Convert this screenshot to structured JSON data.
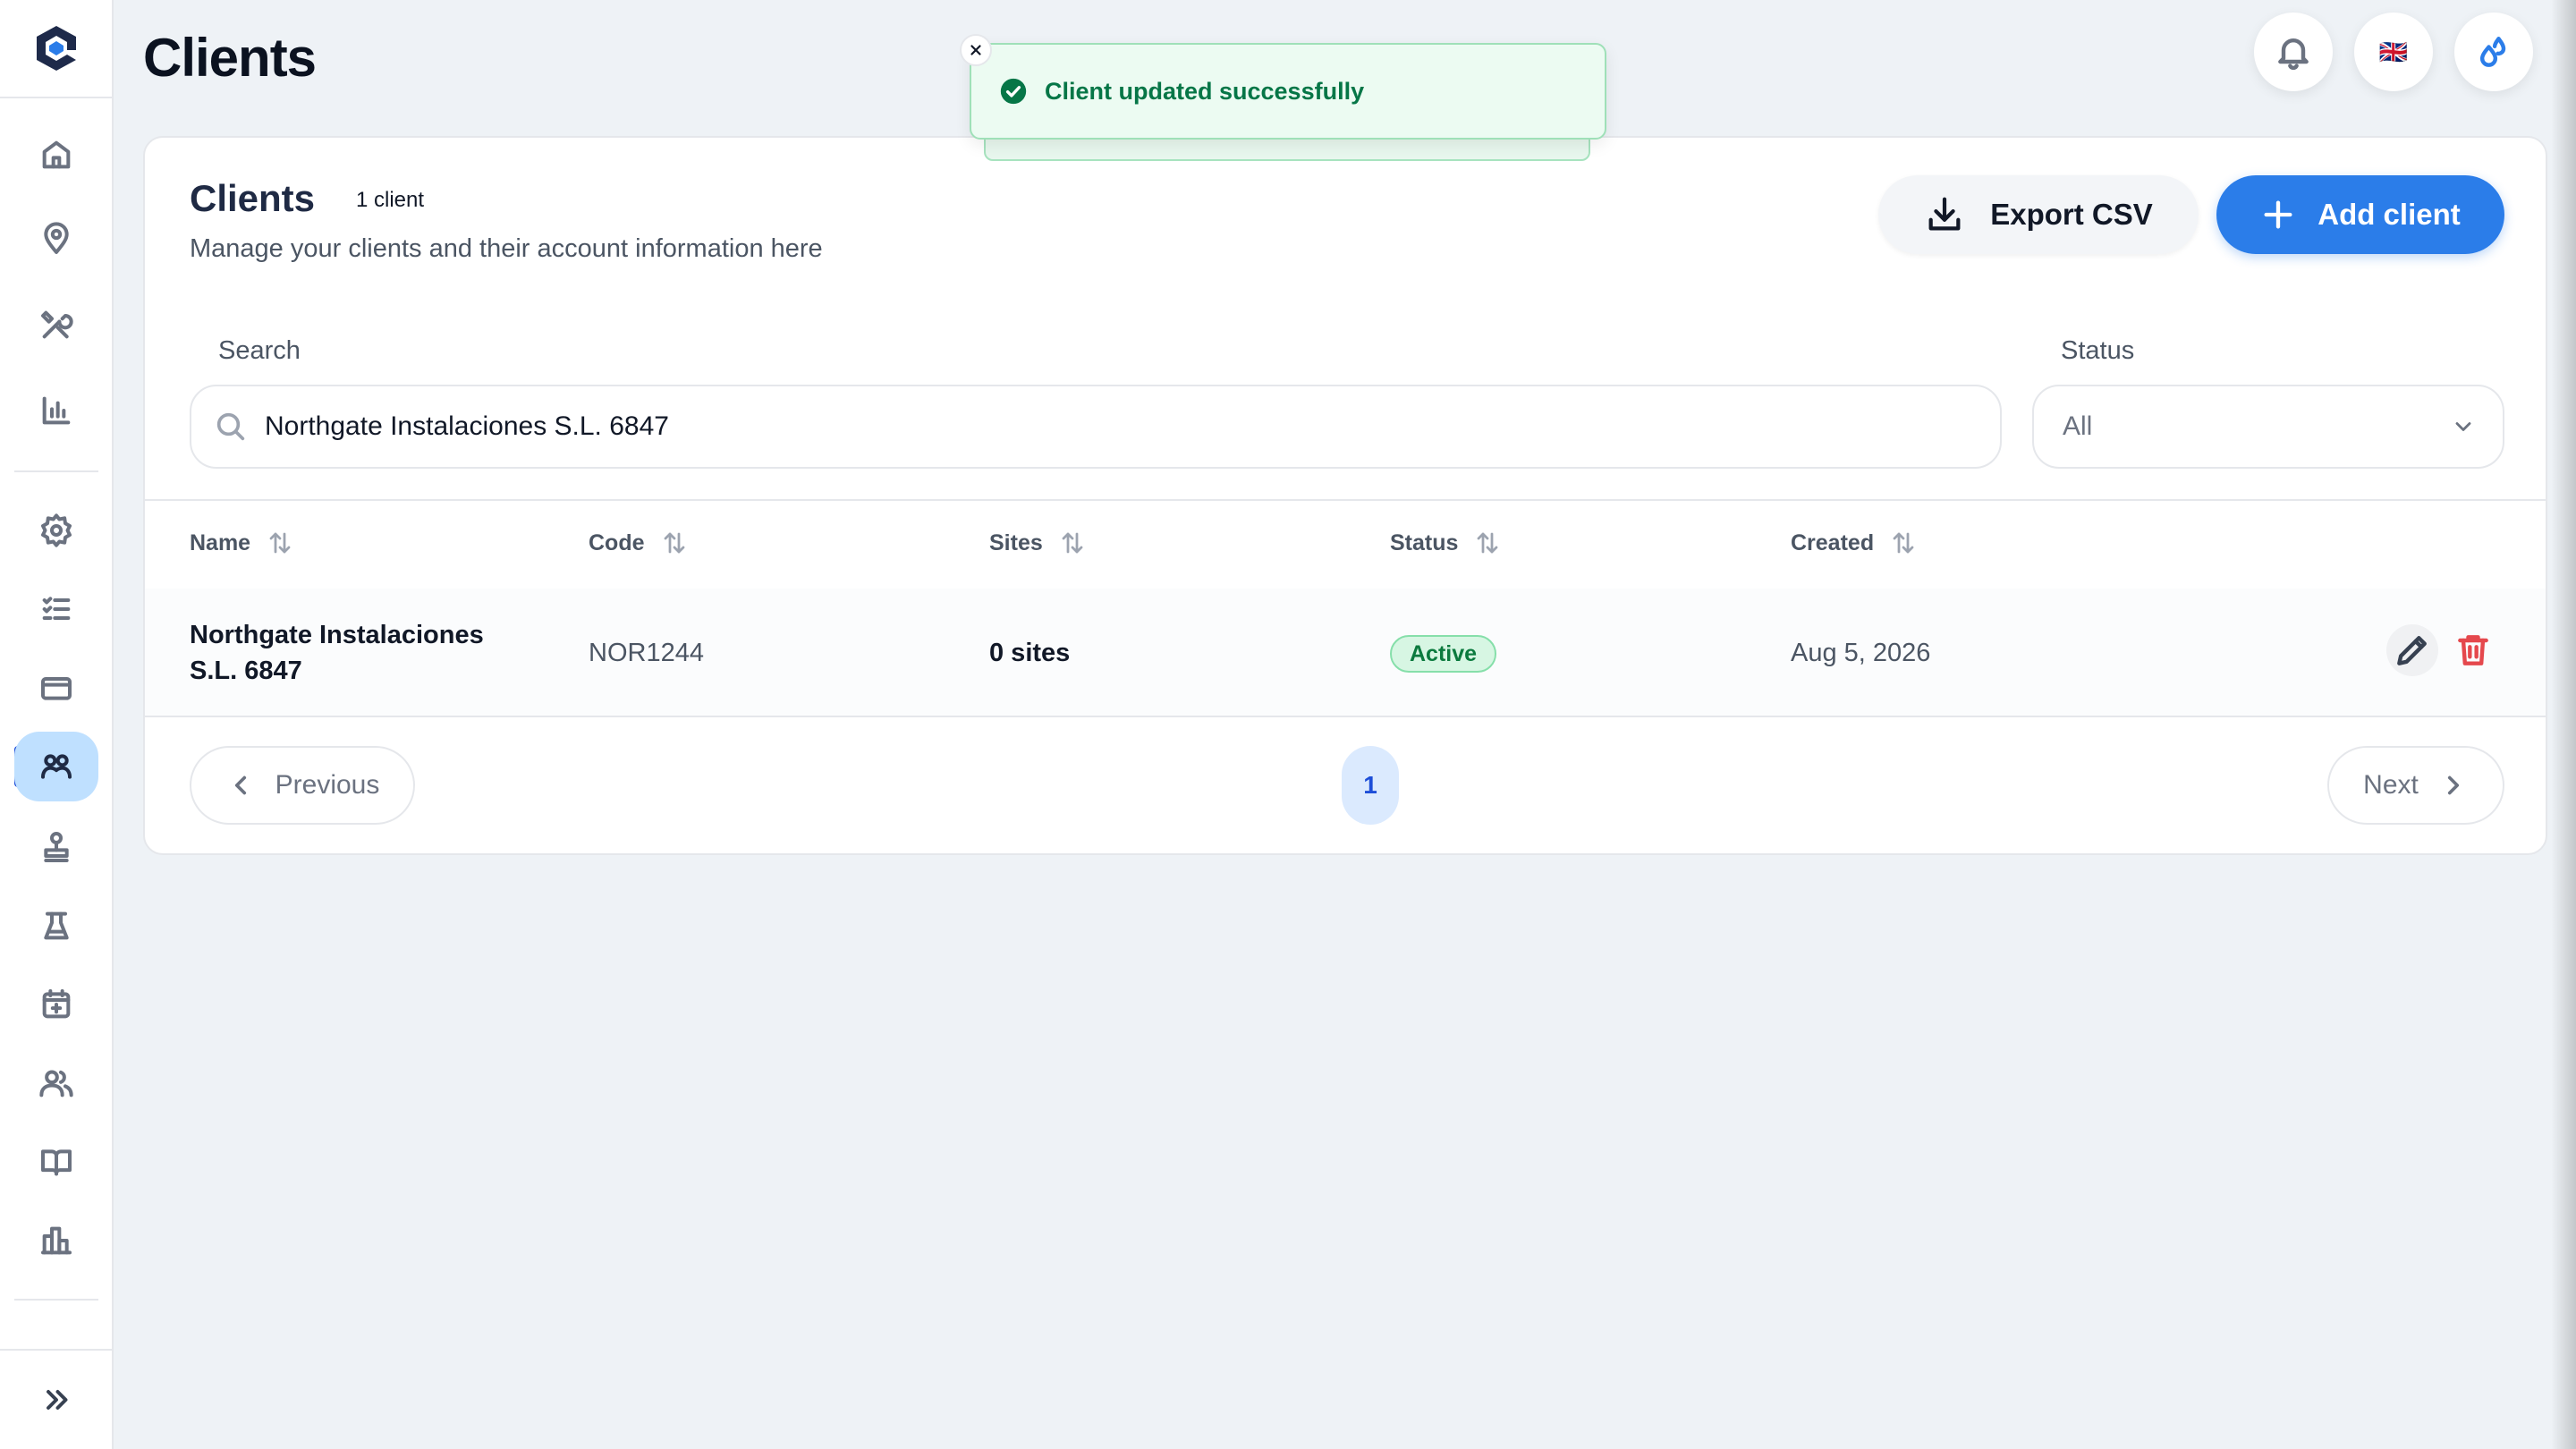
{
  "page": {
    "title": "Clients"
  },
  "header": {
    "language_flag": "🇬🇧"
  },
  "toast": {
    "message": "Client updated successfully"
  },
  "card": {
    "title": "Clients",
    "count": "1 client",
    "subtitle": "Manage your clients and their account information here",
    "export_label": "Export CSV",
    "add_label": "Add client"
  },
  "filters": {
    "search_label": "Search",
    "search_value": "Northgate Instalaciones S.L. 6847",
    "status_label": "Status",
    "status_value": "All"
  },
  "table": {
    "columns": [
      "Name",
      "Code",
      "Sites",
      "Status",
      "Created"
    ],
    "rows": [
      {
        "name_line1": "Northgate Instalaciones",
        "name_line2": "S.L. 6847",
        "code": "NOR1244",
        "sites": "0 sites",
        "status": "Active",
        "created": "Aug 5, 2026"
      }
    ]
  },
  "pagination": {
    "previous": "Previous",
    "next": "Next",
    "current_page": "1"
  },
  "colors": {
    "accent": "#2b7de9",
    "success": "#067647",
    "danger": "#e5484d",
    "background": "#eef2f6"
  }
}
